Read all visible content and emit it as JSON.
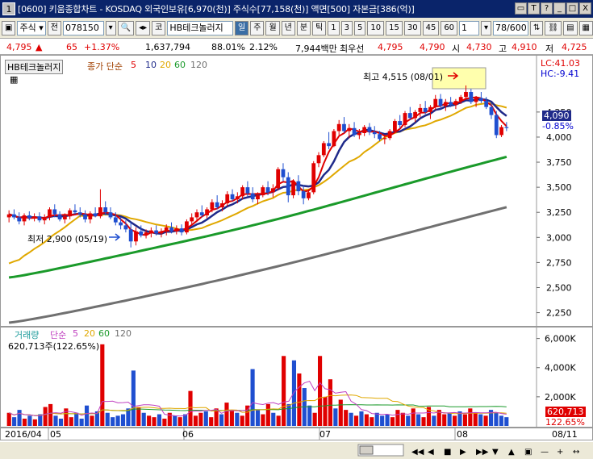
{
  "window": {
    "number": "1",
    "title": "[0600] 키움종합차트 - KOSDAQ 외국인보유[6,970(천)] 주식수[77,158(천)] 액면[500] 자본금[386(억)]",
    "buttons": [
      "▭",
      "T",
      "?",
      "_",
      "□",
      "X"
    ]
  },
  "toolbar": {
    "market": "주식",
    "prev_label": "전",
    "code": "078150",
    "search_label": "코",
    "stock_name": "HB테크놀러지",
    "periods": [
      "일",
      "주",
      "월",
      "년",
      "분",
      "틱"
    ],
    "intervals": [
      "1",
      "3",
      "5",
      "10",
      "15",
      "30",
      "45",
      "60"
    ],
    "interval_value": "1",
    "page_count": "78/600"
  },
  "quote": {
    "price": "4,795",
    "change": "65",
    "change_pct": "+1.37%",
    "volume": "1,637,794",
    "vol_ratio": "88.01%",
    "turnover": "2.12%",
    "amount": "7,944백만",
    "best_ask_label": "최우선",
    "best_ask": "4,795",
    "best_bid": "4,790",
    "open_label": "시",
    "open": "4,730",
    "high_label": "고",
    "high": "4,910",
    "low_label": "저",
    "low": "4,725"
  },
  "price_panel": {
    "stock_label": "HB테크놀러지",
    "ma_label": "종가 단순",
    "ma_periods": [
      "5",
      "10",
      "20",
      "60",
      "120"
    ],
    "ma_colors": [
      "#e00000",
      "#1f2a8a",
      "#e0a800",
      "#1a9a2a",
      "#707070"
    ],
    "lc": "LC:41.03",
    "hc": "HC:-9.41",
    "current_price": "4,090",
    "current_pct": "-0.85%",
    "high_note": "최고 4,515 (08/01)",
    "low_note": "최저 2,900 (05/19)"
  },
  "volume_panel": {
    "title": "거래량",
    "ma_label": "단순",
    "ma_periods": [
      "5",
      "20",
      "60",
      "120"
    ],
    "current": "620,713주(122.65%)",
    "current_tag": "620,713",
    "current_pct": "122.65%"
  },
  "x_axis": {
    "labels": [
      "2016/04",
      "05",
      "06",
      "07",
      "08",
      "08/11"
    ]
  },
  "chart_data": {
    "type": "candlestick",
    "price_y_ticks": [
      "4,250",
      "4,000",
      "3,750",
      "3,500",
      "3,250",
      "3,000",
      "2,750",
      "2,500",
      "2,250"
    ],
    "volume_y_ticks": [
      "6,000K",
      "4,000K",
      "2,000K"
    ],
    "ohlc": [
      [
        3200,
        3270,
        3150,
        3230
      ],
      [
        3230,
        3280,
        3180,
        3200
      ],
      [
        3200,
        3250,
        3130,
        3160
      ],
      [
        3160,
        3240,
        3120,
        3220
      ],
      [
        3220,
        3260,
        3170,
        3190
      ],
      [
        3190,
        3240,
        3160,
        3210
      ],
      [
        3210,
        3250,
        3150,
        3170
      ],
      [
        3170,
        3230,
        3130,
        3200
      ],
      [
        3200,
        3300,
        3170,
        3280
      ],
      [
        3280,
        3330,
        3200,
        3230
      ],
      [
        3230,
        3260,
        3160,
        3180
      ],
      [
        3180,
        3240,
        3140,
        3210
      ],
      [
        3210,
        3290,
        3180,
        3270
      ],
      [
        3270,
        3330,
        3230,
        3250
      ],
      [
        3250,
        3300,
        3200,
        3230
      ],
      [
        3230,
        3270,
        3150,
        3180
      ],
      [
        3180,
        3260,
        3140,
        3240
      ],
      [
        3240,
        3300,
        3200,
        3210
      ],
      [
        3210,
        3480,
        3190,
        3300
      ],
      [
        3300,
        3360,
        3220,
        3250
      ],
      [
        3250,
        3300,
        3180,
        3200
      ],
      [
        3200,
        3250,
        3120,
        3150
      ],
      [
        3150,
        3200,
        3080,
        3120
      ],
      [
        3120,
        3170,
        3050,
        3080
      ],
      [
        3080,
        3150,
        2900,
        2960
      ],
      [
        2960,
        3100,
        2920,
        3060
      ],
      [
        3060,
        3120,
        3000,
        3020
      ],
      [
        3020,
        3080,
        2990,
        3050
      ],
      [
        3050,
        3100,
        3000,
        3070
      ],
      [
        3070,
        3120,
        3020,
        3040
      ],
      [
        3040,
        3090,
        3000,
        3060
      ],
      [
        3060,
        3130,
        3020,
        3100
      ],
      [
        3100,
        3150,
        3040,
        3060
      ],
      [
        3060,
        3120,
        3030,
        3090
      ],
      [
        3090,
        3130,
        3020,
        3050
      ],
      [
        3050,
        3180,
        3030,
        3160
      ],
      [
        3160,
        3240,
        3130,
        3200
      ],
      [
        3200,
        3280,
        3170,
        3250
      ],
      [
        3250,
        3320,
        3200,
        3220
      ],
      [
        3220,
        3300,
        3190,
        3280
      ],
      [
        3280,
        3380,
        3250,
        3350
      ],
      [
        3350,
        3420,
        3280,
        3300
      ],
      [
        3300,
        3370,
        3260,
        3340
      ],
      [
        3340,
        3460,
        3310,
        3430
      ],
      [
        3430,
        3480,
        3360,
        3380
      ],
      [
        3380,
        3450,
        3340,
        3410
      ],
      [
        3410,
        3520,
        3380,
        3500
      ],
      [
        3500,
        3560,
        3400,
        3440
      ],
      [
        3440,
        3500,
        3350,
        3380
      ],
      [
        3380,
        3450,
        3330,
        3420
      ],
      [
        3420,
        3520,
        3400,
        3500
      ],
      [
        3500,
        3560,
        3420,
        3450
      ],
      [
        3450,
        3530,
        3400,
        3490
      ],
      [
        3490,
        3700,
        3470,
        3680
      ],
      [
        3680,
        3740,
        3560,
        3600
      ],
      [
        3600,
        3650,
        3350,
        3420
      ],
      [
        3420,
        3580,
        3390,
        3560
      ],
      [
        3560,
        3620,
        3420,
        3460
      ],
      [
        3460,
        3520,
        3330,
        3390
      ],
      [
        3390,
        3480,
        3370,
        3450
      ],
      [
        3450,
        3760,
        3430,
        3740
      ],
      [
        3740,
        3850,
        3700,
        3820
      ],
      [
        3820,
        3960,
        3800,
        3940
      ],
      [
        3940,
        4050,
        3880,
        3910
      ],
      [
        3910,
        4080,
        3900,
        4060
      ],
      [
        4060,
        4170,
        4020,
        4130
      ],
      [
        4130,
        4200,
        4040,
        4060
      ],
      [
        4060,
        4130,
        3990,
        4090
      ],
      [
        4090,
        4150,
        4000,
        4020
      ],
      [
        4020,
        4080,
        3980,
        4040
      ],
      [
        4040,
        4120,
        4010,
        4100
      ],
      [
        4100,
        4140,
        4020,
        4050
      ],
      [
        4050,
        4110,
        3990,
        4030
      ],
      [
        4030,
        4060,
        3960,
        3980
      ],
      [
        3980,
        4020,
        3930,
        3990
      ],
      [
        3990,
        4080,
        3970,
        4060
      ],
      [
        4060,
        4180,
        4040,
        4160
      ],
      [
        4160,
        4220,
        4090,
        4120
      ],
      [
        4120,
        4260,
        4100,
        4240
      ],
      [
        4240,
        4300,
        4170,
        4190
      ],
      [
        4190,
        4270,
        4150,
        4250
      ],
      [
        4250,
        4330,
        4200,
        4290
      ],
      [
        4290,
        4360,
        4230,
        4250
      ],
      [
        4250,
        4320,
        4180,
        4300
      ],
      [
        4300,
        4420,
        4270,
        4380
      ],
      [
        4380,
        4430,
        4280,
        4310
      ],
      [
        4310,
        4380,
        4260,
        4350
      ],
      [
        4350,
        4400,
        4300,
        4320
      ],
      [
        4320,
        4380,
        4280,
        4360
      ],
      [
        4360,
        4420,
        4330,
        4400
      ],
      [
        4400,
        4515,
        4370,
        4450
      ],
      [
        4450,
        4480,
        4330,
        4350
      ],
      [
        4350,
        4410,
        4300,
        4390
      ],
      [
        4390,
        4450,
        4340,
        4360
      ],
      [
        4360,
        4400,
        4280,
        4300
      ],
      [
        4300,
        4340,
        4180,
        4220
      ],
      [
        4220,
        4260,
        3990,
        4020
      ],
      [
        4020,
        4120,
        4000,
        4100
      ],
      [
        4100,
        4150,
        4060,
        4090
      ]
    ],
    "volume_k": [
      900,
      600,
      1100,
      500,
      700,
      450,
      800,
      1300,
      1500,
      700,
      500,
      1200,
      600,
      900,
      500,
      1400,
      700,
      1000,
      5600,
      900,
      600,
      700,
      800,
      1200,
      3800,
      1300,
      900,
      700,
      600,
      800,
      500,
      900,
      700,
      600,
      800,
      2400,
      700,
      900,
      1000,
      600,
      1200,
      800,
      1600,
      1100,
      900,
      700,
      1400,
      3900,
      1100,
      800,
      1500,
      900,
      700,
      4800,
      1500,
      4500,
      3600,
      2600,
      1400,
      900,
      4800,
      2000,
      3200,
      1200,
      1800,
      1100,
      900,
      700,
      1000,
      800,
      600,
      900,
      700,
      800,
      600,
      1100,
      900,
      700,
      1200,
      800,
      600,
      1300,
      700,
      1100,
      800,
      900,
      700,
      1000,
      800,
      1200,
      900,
      800,
      700,
      1100,
      900,
      700,
      600
    ],
    "ma": {
      "5": {
        "start": 3220,
        "end": 4100
      },
      "10": {
        "start": 3150,
        "end": 4210
      },
      "20": {
        "start": 2700,
        "end": 4230
      },
      "60": {
        "start": 2600,
        "end": 3800
      },
      "120": {
        "start": 2150,
        "end": 3300
      }
    }
  }
}
